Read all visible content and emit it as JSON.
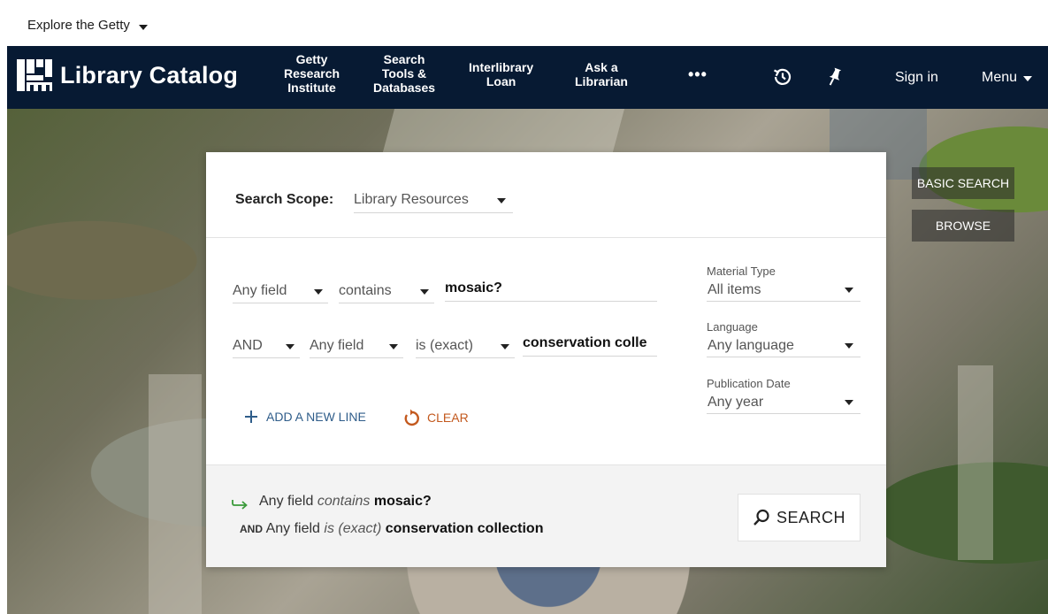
{
  "explore": {
    "label": "Explore the Getty"
  },
  "header": {
    "brand": "Library Catalog",
    "nav": [
      {
        "lines": [
          "Getty",
          "Research",
          "Institute"
        ]
      },
      {
        "lines": [
          "Search",
          "Tools &",
          "Databases"
        ]
      },
      {
        "lines": [
          "Interlibrary",
          "Loan"
        ]
      },
      {
        "lines": [
          "Ask a",
          "Librarian"
        ]
      }
    ],
    "more": "•••",
    "sign_in": "Sign in",
    "menu": "Menu",
    "icons": [
      "history-icon",
      "pin-icon"
    ]
  },
  "side_tabs": {
    "basic_search": "BASIC SEARCH",
    "browse": "BROWSE"
  },
  "search_scope": {
    "label": "Search Scope:",
    "value": "Library Resources"
  },
  "query": {
    "row1": {
      "field": "Any field",
      "operator": "contains",
      "value": "mosaic?"
    },
    "row2": {
      "boolean": "AND",
      "field": "Any field",
      "operator": "is (exact)",
      "value": "conservation colle"
    }
  },
  "facets": [
    {
      "label": "Material Type",
      "value": "All items"
    },
    {
      "label": "Language",
      "value": "Any language"
    },
    {
      "label": "Publication Date",
      "value": "Any year"
    }
  ],
  "actions": {
    "add_line": "ADD A NEW LINE",
    "clear": "CLEAR"
  },
  "summary": {
    "line1": {
      "field": "Any field",
      "operator": "contains",
      "value": "mosaic?"
    },
    "line2": {
      "boolean": "AND",
      "field": "Any field",
      "operator": "is (exact)",
      "value": "conservation collection"
    }
  },
  "search_button": "SEARCH",
  "colors": {
    "navbar": "#071a33",
    "accent_blue": "#2f5d8a",
    "clear_orange": "#c3591e",
    "arrow_green": "#3a9a3a"
  }
}
